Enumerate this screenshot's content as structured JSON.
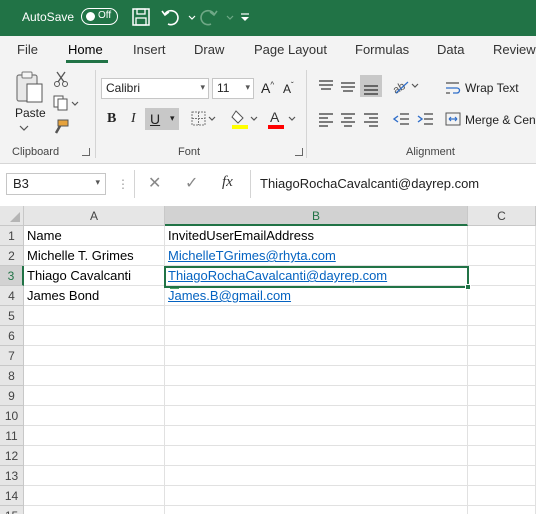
{
  "titlebar": {
    "autosave_label": "AutoSave",
    "toggle_state": "Off",
    "icons": [
      "save-icon",
      "undo-icon",
      "redo-icon",
      "customize-quick-access-icon"
    ]
  },
  "tabs": [
    "File",
    "Home",
    "Insert",
    "Draw",
    "Page Layout",
    "Formulas",
    "Data",
    "Review"
  ],
  "active_tab": "Home",
  "ribbon": {
    "clipboard": {
      "paste_label": "Paste",
      "group_label": "Clipboard"
    },
    "font": {
      "font_name": "Calibri",
      "font_size": "11",
      "group_label": "Font",
      "bold": "B",
      "italic": "I",
      "underline": "U",
      "font_color": "#ff0000",
      "highlight_color": "#ffff00"
    },
    "alignment": {
      "wrap_text_label": "Wrap Text",
      "merge_label": "Merge & Cen",
      "group_label": "Alignment"
    }
  },
  "formula_bar": {
    "name_box": "B3",
    "fx_label": "fx",
    "content": "ThiagoRochaCavalcanti@dayrep.com"
  },
  "sheet": {
    "columns": [
      "A",
      "B",
      "C"
    ],
    "selected_column": "B",
    "selected_row": "3",
    "row_numbers": [
      "1",
      "2",
      "3",
      "4",
      "5",
      "6",
      "7",
      "8",
      "9",
      "10",
      "11",
      "12",
      "13",
      "14",
      "15"
    ],
    "rows": [
      {
        "a": "Name",
        "b": "InvitedUserEmailAddress"
      },
      {
        "a": "Michelle T. Grimes",
        "b": "MichelleTGrimes@rhyta.com"
      },
      {
        "a": "Thiago Cavalcanti",
        "b": "ThiagoRochaCavalcanti@dayrep.com"
      },
      {
        "a": "James Bond",
        "b": "James.B@gmail.com"
      }
    ]
  },
  "colors": {
    "accent": "#217346",
    "link": "#0563c1"
  }
}
